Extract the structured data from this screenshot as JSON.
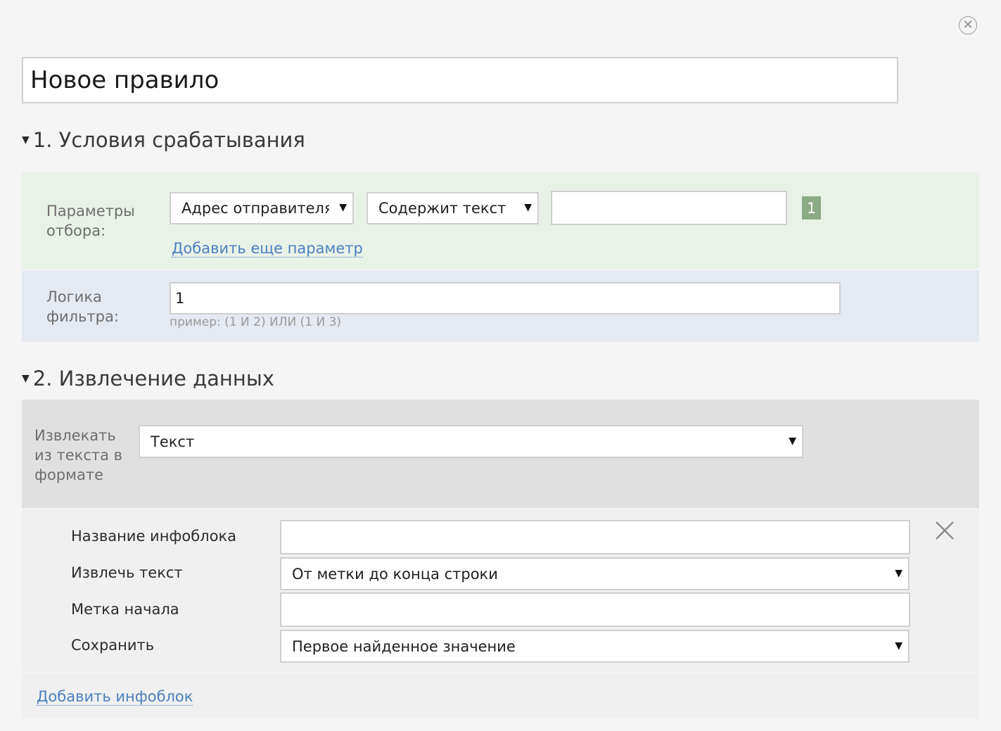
{
  "dialog": {
    "close_icon": "close-circle-icon",
    "rule_name": "Новое правило"
  },
  "section1": {
    "title": "1. Условия срабатывания",
    "params_label": "Параметры\nотбора:",
    "params_label_line1": "Параметры",
    "params_label_line2": "отбора:",
    "field_select": "Адрес отправителя",
    "condition_select": "Содержит текст",
    "value_input": "",
    "param_number": "1",
    "add_param_link": "Добавить еще параметр",
    "logic_label_line1": "Логика",
    "logic_label_line2": "фильтра:",
    "logic_value": "1",
    "logic_hint": "пример: (1 И 2) ИЛИ (1 И 3)"
  },
  "section2": {
    "title": "2. Извлечение данных",
    "extract_label_line1": "Извлекать",
    "extract_label_line2": "из текста в",
    "extract_label_line3": "формате",
    "format_select": "Текст",
    "infoblock": {
      "name_label": "Название инфоблока",
      "name_value": "",
      "extract_label": "Извлечь текст",
      "extract_select": "От метки до конца строки",
      "start_label": "Метка начала",
      "start_value": "",
      "save_label": "Сохранить",
      "save_select": "Первое найденное значение"
    },
    "add_infoblock_link": "Добавить инфоблок"
  }
}
